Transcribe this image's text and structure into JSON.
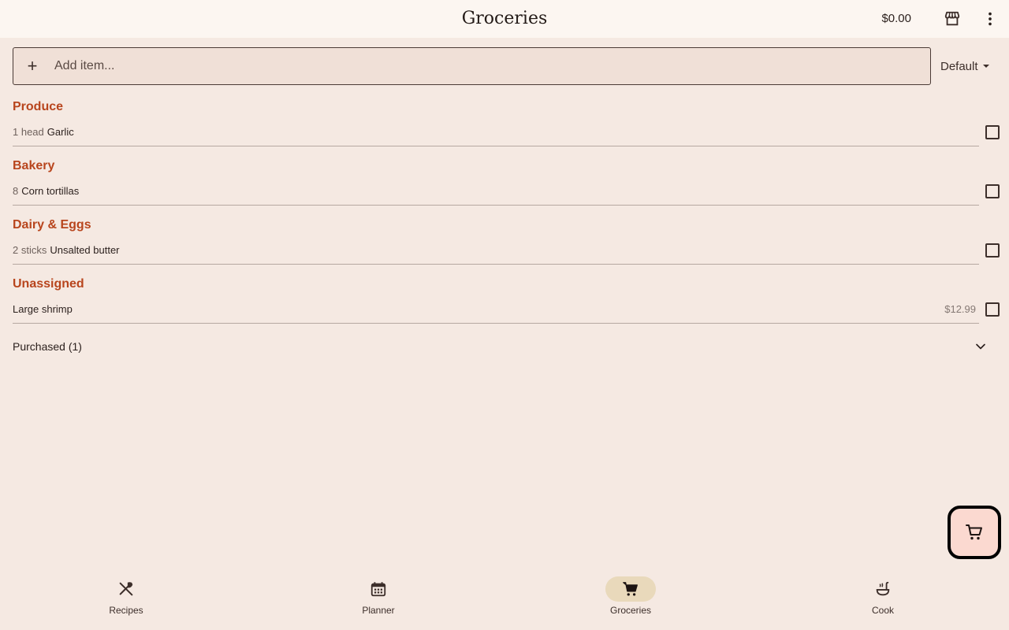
{
  "topbar": {
    "title": "Groceries",
    "total": "$0.00"
  },
  "add": {
    "plus": "+",
    "placeholder": "Add item..."
  },
  "sort": {
    "value": "Default"
  },
  "sections": [
    {
      "title": "Produce",
      "items": [
        {
          "qty": "1 head",
          "name": "Garlic",
          "price": ""
        }
      ]
    },
    {
      "title": "Bakery",
      "items": [
        {
          "qty": "8",
          "name": "Corn tortillas",
          "price": ""
        }
      ]
    },
    {
      "title": "Dairy & Eggs",
      "items": [
        {
          "qty": "2 sticks",
          "name": "Unsalted butter",
          "price": ""
        }
      ]
    },
    {
      "title": "Unassigned",
      "items": [
        {
          "qty": "",
          "name": "Large shrimp",
          "price": "$12.99"
        }
      ]
    }
  ],
  "purchased": {
    "label": "Purchased (1)"
  },
  "nav": {
    "items": [
      {
        "label": "Recipes",
        "icon": "fork-knife-icon"
      },
      {
        "label": "Planner",
        "icon": "calendar-icon"
      },
      {
        "label": "Groceries",
        "icon": "cart-icon"
      },
      {
        "label": "Cook",
        "icon": "ladle-pot-icon"
      }
    ],
    "active": "Groceries"
  },
  "colors": {
    "background": "#f5e9e2",
    "topbar": "#fcf6f1",
    "accent": "#b8451d",
    "nav_active": "#e9d9bb",
    "fab": "#fbd9d0"
  }
}
